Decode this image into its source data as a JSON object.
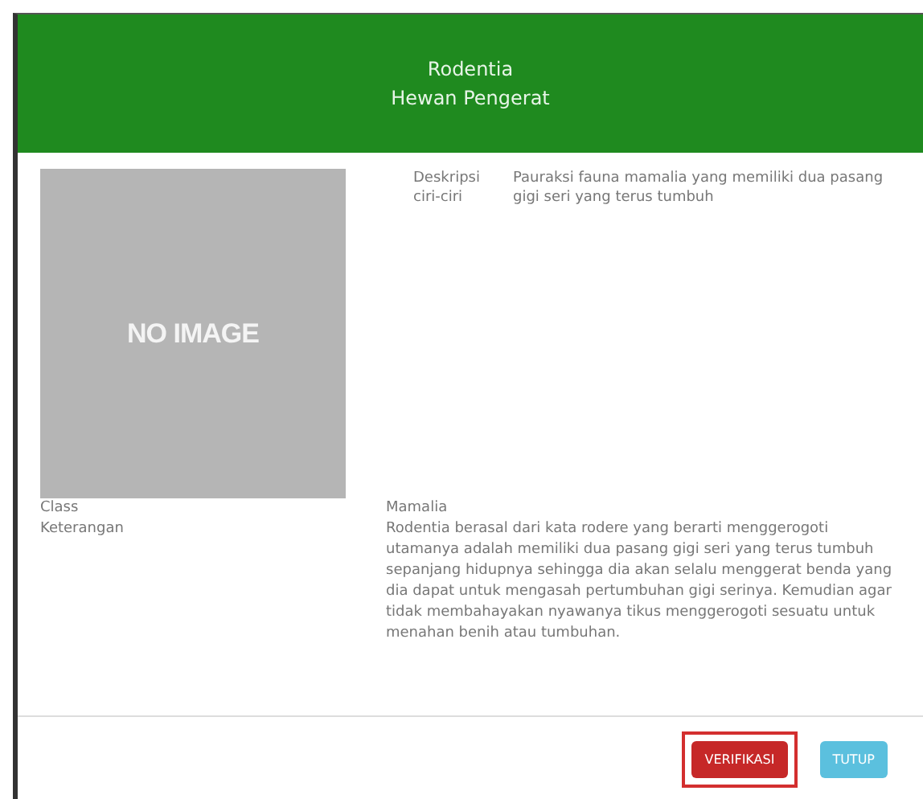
{
  "header": {
    "title": "Rodentia",
    "subtitle": "Hewan Pengerat"
  },
  "image": {
    "placeholder_text": "NO IMAGE"
  },
  "top_details": [
    {
      "label": "Deskripsi",
      "label_2": "ciri-ciri",
      "value": "Pauraksi fauna mamalia yang memiliki dua pasang gigi seri yang terus tumbuh"
    }
  ],
  "bottom_details": [
    {
      "label": "Class",
      "label_2": "Keterangan",
      "value": "Mamalia",
      "value_2": "Rodentia berasal dari kata rodere yang berarti menggerogoti utamanya adalah memiliki dua pasang gigi seri yang terus tumbuh sepanjang hidupnya sehingga dia akan selalu menggerat benda yang dia dapat untuk mengasah pertumbuhan gigi serinya. Kemudian agar tidak membahayakan nyawanya tikus menggerogoti sesuatu untuk menahan benih atau tumbuhan."
    }
  ],
  "buttons": [
    {
      "label": "VERIFIKASI",
      "kind": "danger",
      "highlighted": true
    },
    {
      "label": "TUTUP",
      "kind": "info",
      "highlighted": false
    }
  ]
}
